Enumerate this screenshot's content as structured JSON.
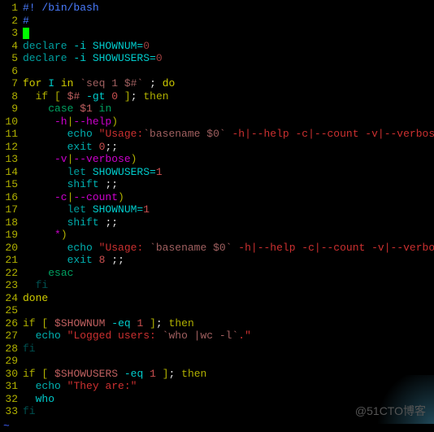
{
  "watermark": "@51CTO博客",
  "tilde": "~",
  "lines": [
    {
      "n": 1,
      "segs": [
        {
          "t": "#!",
          "c": "c-comment"
        },
        {
          "t": " /bin/bash",
          "c": "c-comment"
        }
      ]
    },
    {
      "n": 2,
      "segs": [
        {
          "t": "#",
          "c": "c-comment"
        }
      ]
    },
    {
      "n": 3,
      "segs": [],
      "cursor": true
    },
    {
      "n": 4,
      "segs": [
        {
          "t": "declare",
          "c": "c-declare"
        },
        {
          "t": " -i SHOWNUM=",
          "c": "c-cyan"
        },
        {
          "t": "0",
          "c": "c-num0"
        }
      ]
    },
    {
      "n": 5,
      "segs": [
        {
          "t": "declare",
          "c": "c-declare"
        },
        {
          "t": " -i SHOWUSERS=",
          "c": "c-cyan"
        },
        {
          "t": "0",
          "c": "c-num0"
        }
      ]
    },
    {
      "n": 6,
      "segs": []
    },
    {
      "n": 7,
      "segs": [
        {
          "t": "for",
          "c": "c-for"
        },
        {
          "t": " I ",
          "c": "c-cyan"
        },
        {
          "t": "in",
          "c": "c-for"
        },
        {
          "t": " ",
          "c": "c-cyan"
        },
        {
          "t": "`seq 1 $#`",
          "c": "c-spec"
        },
        {
          "t": " ",
          "c": "c-cyan"
        },
        {
          "t": ";",
          "c": "c-white"
        },
        {
          "t": " ",
          "c": "c-cyan"
        },
        {
          "t": "do",
          "c": "c-for"
        }
      ]
    },
    {
      "n": 8,
      "segs": [
        {
          "t": "  ",
          "c": "c-cyan"
        },
        {
          "t": "if",
          "c": "c-kw"
        },
        {
          "t": " ",
          "c": "c-cyan"
        },
        {
          "t": "[",
          "c": "c-kw"
        },
        {
          "t": " ",
          "c": "c-cyan"
        },
        {
          "t": "$#",
          "c": "c-spec2"
        },
        {
          "t": " -gt ",
          "c": "c-cyan"
        },
        {
          "t": "0",
          "c": "c-num1"
        },
        {
          "t": " ",
          "c": "c-cyan"
        },
        {
          "t": "]",
          "c": "c-kw"
        },
        {
          "t": ";",
          "c": "c-white"
        },
        {
          "t": " ",
          "c": "c-cyan"
        },
        {
          "t": "then",
          "c": "c-kw"
        }
      ]
    },
    {
      "n": 9,
      "segs": [
        {
          "t": "    ",
          "c": "c-cyan"
        },
        {
          "t": "case",
          "c": "c-case"
        },
        {
          "t": " ",
          "c": "c-cyan"
        },
        {
          "t": "$1",
          "c": "c-spec2"
        },
        {
          "t": " ",
          "c": "c-cyan"
        },
        {
          "t": "in",
          "c": "c-case"
        }
      ]
    },
    {
      "n": 10,
      "segs": [
        {
          "t": "     -h",
          "c": "c-opt"
        },
        {
          "t": "|",
          "c": "c-kw"
        },
        {
          "t": "--help",
          "c": "c-opt"
        },
        {
          "t": ")",
          "c": "c-kw"
        }
      ]
    },
    {
      "n": 11,
      "segs": [
        {
          "t": "       ",
          "c": "c-cyan"
        },
        {
          "t": "echo",
          "c": "c-echo"
        },
        {
          "t": " ",
          "c": "c-cyan"
        },
        {
          "t": "\"Usage:",
          "c": "c-str"
        },
        {
          "t": "`basename $0`",
          "c": "c-spec"
        },
        {
          "t": " -h|--help -c|--count -v|--verbose\"",
          "c": "c-str"
        }
      ]
    },
    {
      "n": 12,
      "segs": [
        {
          "t": "       ",
          "c": "c-cyan"
        },
        {
          "t": "exit",
          "c": "c-echo"
        },
        {
          "t": " ",
          "c": "c-cyan"
        },
        {
          "t": "0",
          "c": "c-num1"
        },
        {
          "t": ";;",
          "c": "c-white"
        }
      ]
    },
    {
      "n": 13,
      "segs": [
        {
          "t": "     -v",
          "c": "c-opt"
        },
        {
          "t": "|",
          "c": "c-kw"
        },
        {
          "t": "--verbose",
          "c": "c-opt"
        },
        {
          "t": ")",
          "c": "c-kw"
        }
      ]
    },
    {
      "n": 14,
      "segs": [
        {
          "t": "       ",
          "c": "c-cyan"
        },
        {
          "t": "let",
          "c": "c-let"
        },
        {
          "t": " SHOWUSERS=",
          "c": "c-cyan"
        },
        {
          "t": "1",
          "c": "c-num1"
        }
      ]
    },
    {
      "n": 15,
      "segs": [
        {
          "t": "       ",
          "c": "c-cyan"
        },
        {
          "t": "shift",
          "c": "c-echo"
        },
        {
          "t": " ",
          "c": "c-cyan"
        },
        {
          "t": ";;",
          "c": "c-white"
        }
      ]
    },
    {
      "n": 16,
      "segs": [
        {
          "t": "     -c",
          "c": "c-opt"
        },
        {
          "t": "|",
          "c": "c-kw"
        },
        {
          "t": "--count",
          "c": "c-opt"
        },
        {
          "t": ")",
          "c": "c-kw"
        }
      ]
    },
    {
      "n": 17,
      "segs": [
        {
          "t": "       ",
          "c": "c-cyan"
        },
        {
          "t": "let",
          "c": "c-let"
        },
        {
          "t": " SHOWNUM=",
          "c": "c-cyan"
        },
        {
          "t": "1",
          "c": "c-num1"
        }
      ]
    },
    {
      "n": 18,
      "segs": [
        {
          "t": "       ",
          "c": "c-cyan"
        },
        {
          "t": "shift",
          "c": "c-echo"
        },
        {
          "t": " ",
          "c": "c-cyan"
        },
        {
          "t": ";;",
          "c": "c-white"
        }
      ]
    },
    {
      "n": 19,
      "segs": [
        {
          "t": "     *",
          "c": "c-opt"
        },
        {
          "t": ")",
          "c": "c-kw"
        }
      ]
    },
    {
      "n": 20,
      "segs": [
        {
          "t": "       ",
          "c": "c-cyan"
        },
        {
          "t": "echo",
          "c": "c-echo"
        },
        {
          "t": " ",
          "c": "c-cyan"
        },
        {
          "t": "\"Usage: ",
          "c": "c-str"
        },
        {
          "t": "`basename $0`",
          "c": "c-spec"
        },
        {
          "t": " -h|--help -c|--count -v|--verbose\"",
          "c": "c-str"
        }
      ]
    },
    {
      "n": 21,
      "segs": [
        {
          "t": "       ",
          "c": "c-cyan"
        },
        {
          "t": "exit",
          "c": "c-echo"
        },
        {
          "t": " ",
          "c": "c-cyan"
        },
        {
          "t": "8",
          "c": "c-num1"
        },
        {
          "t": " ",
          "c": "c-cyan"
        },
        {
          "t": ";;",
          "c": "c-white"
        }
      ]
    },
    {
      "n": 22,
      "segs": [
        {
          "t": "    ",
          "c": "c-cyan"
        },
        {
          "t": "esac",
          "c": "c-case"
        }
      ]
    },
    {
      "n": 23,
      "segs": [
        {
          "t": "  ",
          "c": "c-cyan"
        },
        {
          "t": "fi",
          "c": "c-fi"
        }
      ]
    },
    {
      "n": 24,
      "segs": [
        {
          "t": "done",
          "c": "c-for"
        }
      ]
    },
    {
      "n": 25,
      "segs": []
    },
    {
      "n": 26,
      "segs": [
        {
          "t": "if",
          "c": "c-kw"
        },
        {
          "t": " ",
          "c": "c-cyan"
        },
        {
          "t": "[",
          "c": "c-kw"
        },
        {
          "t": " ",
          "c": "c-cyan"
        },
        {
          "t": "$SHOWNUM",
          "c": "c-spec2"
        },
        {
          "t": " -eq ",
          "c": "c-cyan"
        },
        {
          "t": "1",
          "c": "c-num1"
        },
        {
          "t": " ",
          "c": "c-cyan"
        },
        {
          "t": "]",
          "c": "c-kw"
        },
        {
          "t": ";",
          "c": "c-white"
        },
        {
          "t": " ",
          "c": "c-cyan"
        },
        {
          "t": "then",
          "c": "c-kw"
        }
      ]
    },
    {
      "n": 27,
      "segs": [
        {
          "t": "  ",
          "c": "c-cyan"
        },
        {
          "t": "echo",
          "c": "c-echo"
        },
        {
          "t": " ",
          "c": "c-cyan"
        },
        {
          "t": "\"Logged users: ",
          "c": "c-str"
        },
        {
          "t": "`who |wc -l`",
          "c": "c-spec"
        },
        {
          "t": ".\"",
          "c": "c-str"
        }
      ]
    },
    {
      "n": 28,
      "segs": [
        {
          "t": "fi",
          "c": "c-fi"
        }
      ]
    },
    {
      "n": 29,
      "segs": []
    },
    {
      "n": 30,
      "segs": [
        {
          "t": "if",
          "c": "c-kw"
        },
        {
          "t": " ",
          "c": "c-cyan"
        },
        {
          "t": "[",
          "c": "c-kw"
        },
        {
          "t": " ",
          "c": "c-cyan"
        },
        {
          "t": "$SHOWUSERS",
          "c": "c-spec2"
        },
        {
          "t": " -eq ",
          "c": "c-cyan"
        },
        {
          "t": "1",
          "c": "c-num1"
        },
        {
          "t": " ",
          "c": "c-cyan"
        },
        {
          "t": "]",
          "c": "c-kw"
        },
        {
          "t": ";",
          "c": "c-white"
        },
        {
          "t": " ",
          "c": "c-cyan"
        },
        {
          "t": "then",
          "c": "c-kw"
        }
      ]
    },
    {
      "n": 31,
      "segs": [
        {
          "t": "  ",
          "c": "c-cyan"
        },
        {
          "t": "echo",
          "c": "c-echo"
        },
        {
          "t": " ",
          "c": "c-cyan"
        },
        {
          "t": "\"They are:\"",
          "c": "c-str"
        }
      ]
    },
    {
      "n": 32,
      "segs": [
        {
          "t": "  who",
          "c": "c-cyan"
        }
      ]
    },
    {
      "n": 33,
      "segs": [
        {
          "t": "fi",
          "c": "c-fi"
        }
      ]
    }
  ]
}
